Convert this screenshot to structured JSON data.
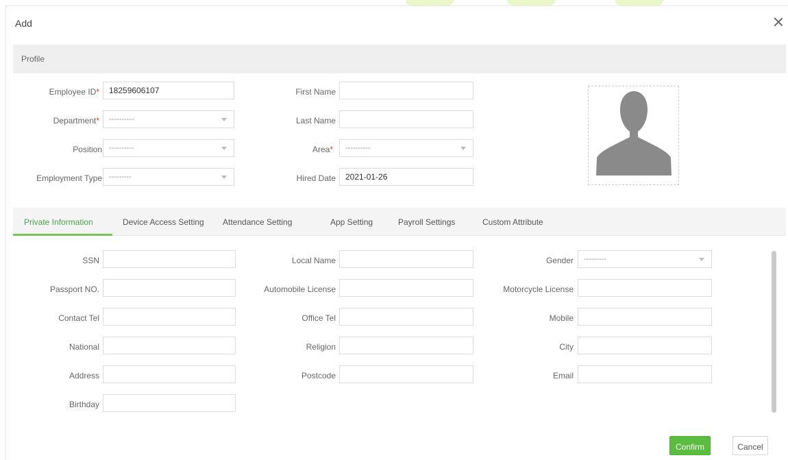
{
  "dialog": {
    "title": "Add"
  },
  "profile": {
    "section_title": "Profile",
    "employee_id_label": "Employee ID",
    "employee_id_value": "18259606107",
    "department_label": "Department",
    "department_value": "----------",
    "position_label": "Position",
    "position_value": "----------",
    "employment_type_label": "Employment Type",
    "employment_type_value": "---------",
    "first_name_label": "First Name",
    "first_name_value": "",
    "last_name_label": "Last Name",
    "last_name_value": "",
    "area_label": "Area",
    "area_value": "----------",
    "hired_date_label": "Hired Date",
    "hired_date_value": "2021-01-26",
    "required_mark": "*"
  },
  "tabs": [
    {
      "label": "Private Information",
      "active": true
    },
    {
      "label": "Device Access Setting",
      "active": false
    },
    {
      "label": "Attendance Setting",
      "active": false
    },
    {
      "label": "App Setting",
      "active": false
    },
    {
      "label": "Payroll Settings",
      "active": false
    },
    {
      "label": "Custom Attribute",
      "active": false
    }
  ],
  "private": {
    "ssn_label": "SSN",
    "ssn_value": "",
    "passport_label": "Passport NO.",
    "passport_value": "",
    "contact_tel_label": "Contact Tel",
    "contact_tel_value": "",
    "national_label": "National",
    "national_value": "",
    "address_label": "Address",
    "address_value": "",
    "birthday_label": "Birthday",
    "birthday_value": "",
    "local_name_label": "Local Name",
    "local_name_value": "",
    "automobile_license_label": "Automobile License",
    "automobile_license_value": "",
    "office_tel_label": "Office Tel",
    "office_tel_value": "",
    "religion_label": "Religion",
    "religion_value": "",
    "postcode_label": "Postcode",
    "postcode_value": "",
    "gender_label": "Gender",
    "gender_value": "---------",
    "motorcycle_license_label": "Motorcycle License",
    "motorcycle_license_value": "",
    "mobile_label": "Mobile",
    "mobile_value": "",
    "city_label": "City",
    "city_value": "",
    "email_label": "Email",
    "email_value": ""
  },
  "buttons": {
    "confirm": "Confirm",
    "cancel": "Cancel"
  },
  "colors": {
    "accent": "#5bbd3f",
    "tab_active": "#4aa54a",
    "required": "#e33333",
    "avatar": "#8a8a8a"
  },
  "icons": {
    "close": "close-icon",
    "avatar": "user-silhouette-icon",
    "dropdown": "caret-down-icon"
  }
}
